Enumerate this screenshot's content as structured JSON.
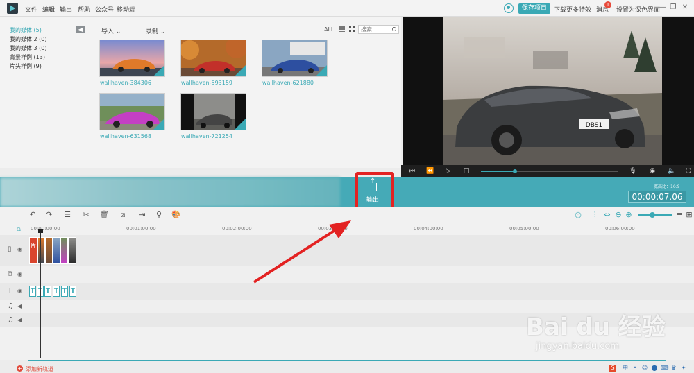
{
  "menubar": {
    "items": [
      "文件",
      "编辑",
      "输出",
      "帮助",
      "公众号",
      "移动端"
    ],
    "save_label": "保存项目",
    "more_effects_label": "下载更多特效",
    "messages_label": "消息",
    "messages_badge": "1",
    "theme_label": "设置为深色界面"
  },
  "library": {
    "categories": [
      {
        "label": "我的媒体 (5)",
        "active": true
      },
      {
        "label": "我的媒体 2 (0)",
        "active": false
      },
      {
        "label": "我的媒体 3 (0)",
        "active": false
      },
      {
        "label": "背景样例 (13)",
        "active": false
      },
      {
        "label": "片头样例 (9)",
        "active": false
      }
    ],
    "import_label": "导入",
    "record_label": "录制",
    "all_label": "ALL",
    "search_placeholder": "搜索",
    "media": [
      {
        "name": "wallhaven-384306",
        "color": "#e07a2a"
      },
      {
        "name": "wallhaven-593159",
        "color": "#c2302a"
      },
      {
        "name": "wallhaven-621880",
        "color": "#2d4fa0"
      },
      {
        "name": "wallhaven-631568",
        "color": "#c43fc4"
      },
      {
        "name": "wallhaven-721254",
        "color": "#444444"
      }
    ]
  },
  "preview": {
    "car_plate": "DBS1"
  },
  "toolbar": {
    "export_label": "输出",
    "resolution_label": "宽高比：16:9",
    "timecode": "00:00:07.06"
  },
  "ruler": {
    "ticks": [
      "00:00:00:00",
      "00:01:00:00",
      "00:02:00:00",
      "00:03:00:00",
      "00:04:00:00",
      "00:05:00:00",
      "00:06:00:00"
    ]
  },
  "tracks": {
    "title_clip_label": "T",
    "first_clip_label": "片"
  },
  "bottom": {
    "add_track_label": "添加新轨道"
  },
  "watermark": {
    "brand": "Bai du 经验",
    "url": "jingyan.baidu.com"
  },
  "colors": {
    "accent": "#3aa9b5",
    "highlight": "#e32222"
  }
}
